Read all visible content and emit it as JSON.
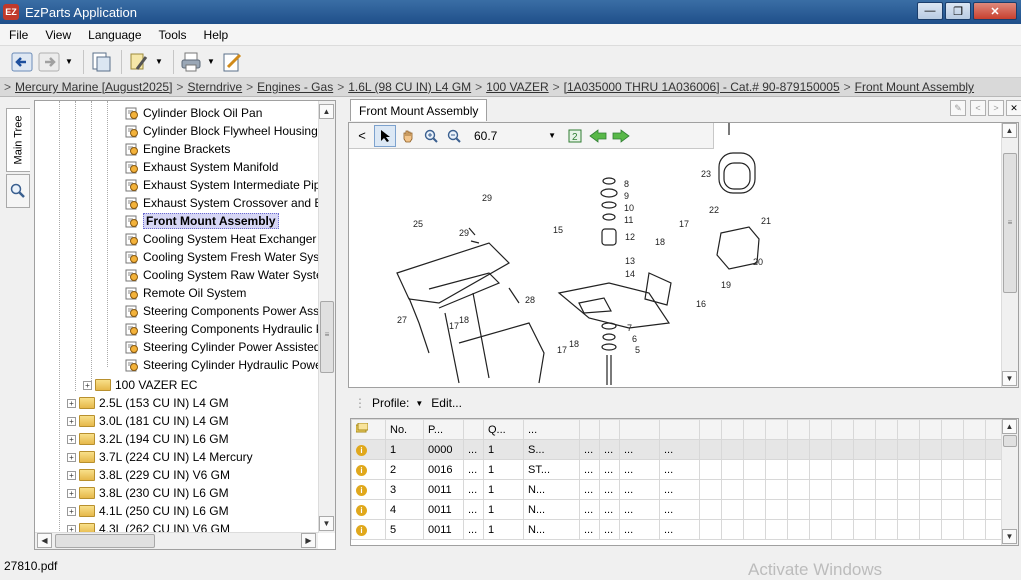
{
  "window": {
    "title": "EzParts Application",
    "icon_text": "EZ"
  },
  "menu": [
    "File",
    "View",
    "Language",
    "Tools",
    "Help"
  ],
  "toolbar_icons": [
    "back-icon",
    "forward-icon",
    "print-preview-icon",
    "tools-icon",
    "print-icon",
    "edit-icon"
  ],
  "breadcrumb": [
    "Mercury Marine [August2025]",
    "Sterndrive",
    "Engines - Gas",
    "1.6L (98 CU IN) L4 GM",
    "100 VAZER",
    "[1A035000 THRU 1A036006] - Cat.# 90-879150005",
    "Front Mount Assembly"
  ],
  "side_tabs": {
    "main": "Main Tree"
  },
  "tree": {
    "parts": [
      "Cylinder Block Oil Pan",
      "Cylinder Block Flywheel Housing and",
      "Engine Brackets",
      "Exhaust System Manifold",
      "Exhaust System Intermediate Pipe a",
      "Exhaust System Crossover and Exh",
      "Front Mount Assembly",
      "Cooling System Heat Exchanger",
      "Cooling System Fresh Water System",
      "Cooling System Raw Water System",
      "Remote Oil System",
      "Steering Components Power Assiste",
      "Steering Components Hydraulic Pow",
      "Steering Cylinder Power Assisted",
      "Steering Cylinder Hydraulic Power S"
    ],
    "selected_index": 6,
    "sibling_model": "100 VAZER EC",
    "engines": [
      "2.5L (153 CU IN) L4 GM",
      "3.0L (181 CU IN) L4 GM",
      "3.2L (194 CU IN) L6 GM",
      "3.7L (224 CU IN) L4 Mercury",
      "3.8L (229 CU IN) V6 GM",
      "3.8L (230 CU IN) L6 GM",
      "4.1L (250 CU IN) L6 GM",
      "4.3L (262 CU IN) V6 GM"
    ]
  },
  "document_tab": "Front Mount Assembly",
  "viewer": {
    "zoom": "60.7"
  },
  "diagram_callouts": [
    "29",
    "25",
    "29",
    "15",
    "8",
    "9",
    "10",
    "11",
    "12",
    "13",
    "14",
    "23",
    "22",
    "21",
    "17",
    "18",
    "20",
    "19",
    "16",
    "28",
    "27",
    "17",
    "18",
    "17",
    "18",
    "7",
    "6",
    "5"
  ],
  "profile": {
    "label": "Profile:",
    "edit": "Edit..."
  },
  "grid": {
    "headers": [
      "No.",
      "P...",
      "Q...",
      "..."
    ],
    "rows": [
      {
        "no": "1",
        "part": "0000",
        "c3": "...",
        "qty": "1",
        "desc": "S...",
        "e1": "...",
        "e2": "...",
        "e3": "...",
        "e4": "..."
      },
      {
        "no": "2",
        "part": "0016",
        "c3": "...",
        "qty": "1",
        "desc": "ST...",
        "e1": "...",
        "e2": "...",
        "e3": "...",
        "e4": "..."
      },
      {
        "no": "3",
        "part": "0011",
        "c3": "...",
        "qty": "1",
        "desc": "N...",
        "e1": "...",
        "e2": "...",
        "e3": "...",
        "e4": "..."
      },
      {
        "no": "4",
        "part": "0011",
        "c3": "...",
        "qty": "1",
        "desc": "N...",
        "e1": "...",
        "e2": "...",
        "e3": "...",
        "e4": "..."
      },
      {
        "no": "5",
        "part": "0011",
        "c3": "...",
        "qty": "1",
        "desc": "N...",
        "e1": "...",
        "e2": "...",
        "e3": "...",
        "e4": "..."
      }
    ]
  },
  "status": {
    "text": "27810.pdf"
  },
  "watermark": "Activate Windows",
  "colors": {
    "titlebar": "#2a5d98",
    "selection": "#d6d6f5",
    "info_icon": "#e0a81c"
  }
}
